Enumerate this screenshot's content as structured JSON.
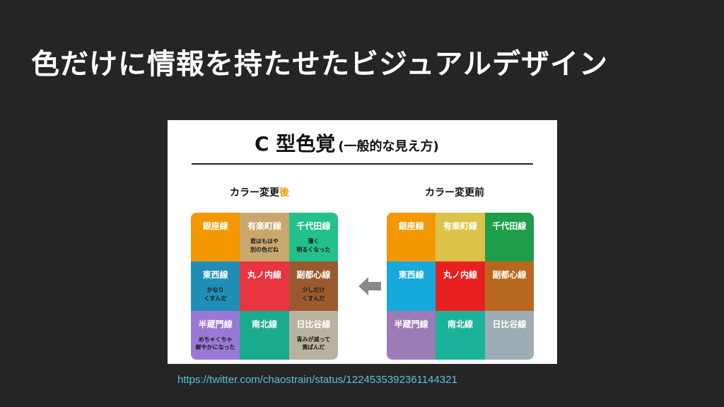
{
  "title": "色だけに情報を持たせたビジュアルデザイン",
  "figure": {
    "heading_main": "C 型色覚",
    "heading_sub": "(一般的な見え方)",
    "caption_after_prefix": "カラー変更",
    "caption_after_accent": "後",
    "caption_before": "カラー変更前",
    "accent_color": "#f39800",
    "arrow_icon": "left-arrow",
    "grid_after": [
      {
        "name": "銀座線",
        "note": "",
        "color": "#f39800",
        "text_color": "#ffffff"
      },
      {
        "name": "有楽町線",
        "note": "君はもはや\n別の色だね",
        "color": "#c9a870",
        "text_color": "#ffffff"
      },
      {
        "name": "千代田線",
        "note": "薄く\n明るくなった",
        "color": "#22c08a",
        "text_color": "#ffffff"
      },
      {
        "name": "東西線",
        "note": "かなり\nくすんだ",
        "color": "#1f8fb8",
        "text_color": "#ffffff"
      },
      {
        "name": "丸ノ内線",
        "note": "",
        "color": "#e8353f",
        "text_color": "#ffffff"
      },
      {
        "name": "副都心線",
        "note": "少しだけ\nくすんだ",
        "color": "#9b5a2e",
        "text_color": "#ffffff"
      },
      {
        "name": "半蔵門線",
        "note": "めちゃくちゃ\n鮮やかになった",
        "color": "#9a79d6",
        "text_color": "#ffffff"
      },
      {
        "name": "南北線",
        "note": "",
        "color": "#1aab8f",
        "text_color": "#ffffff"
      },
      {
        "name": "日比谷線",
        "note": "青みが減って\n黄ばんだ",
        "color": "#b9b39f",
        "text_color": "#ffffff"
      }
    ],
    "grid_before": [
      {
        "name": "銀座線",
        "color": "#f39800",
        "text_color": "#ffffff"
      },
      {
        "name": "有楽町線",
        "color": "#dcc24a",
        "text_color": "#ffffff"
      },
      {
        "name": "千代田線",
        "color": "#1e9e4a",
        "text_color": "#ffffff"
      },
      {
        "name": "東西線",
        "color": "#16a9dc",
        "text_color": "#ffffff"
      },
      {
        "name": "丸ノ内線",
        "color": "#e8201f",
        "text_color": "#ffffff"
      },
      {
        "name": "副都心線",
        "color": "#b8671f",
        "text_color": "#ffffff"
      },
      {
        "name": "半蔵門線",
        "color": "#9b7cb6",
        "text_color": "#ffffff"
      },
      {
        "name": "南北線",
        "color": "#1ab39a",
        "text_color": "#ffffff"
      },
      {
        "name": "日比谷線",
        "color": "#9eadb5",
        "text_color": "#ffffff"
      }
    ]
  },
  "source_url": "https://twitter.com/chaostrain/status/1224535392361144321"
}
